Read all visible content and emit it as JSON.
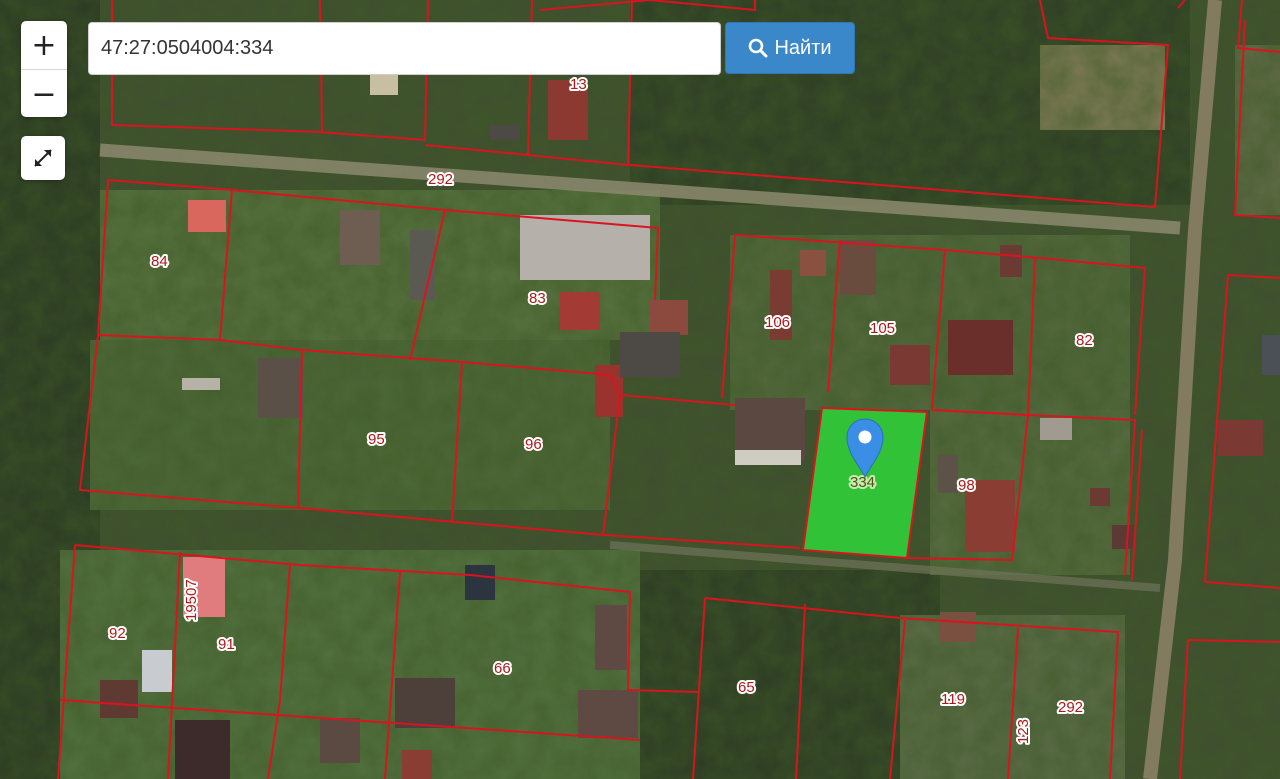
{
  "search": {
    "value": "47:27:0504004:334"
  },
  "search_button": {
    "label": "Найти",
    "icon": "search-icon"
  },
  "zoom": {
    "in_label": "+",
    "out_label": "−"
  },
  "fullscreen": {
    "icon": "expand-icon"
  },
  "map": {
    "boundary_color": "#d9141e",
    "selected_fill": "#2fd63a",
    "selected_parcel": "334",
    "parcel_labels": [
      "13",
      "292",
      "84",
      "83",
      "106",
      "105",
      "82",
      "95",
      "96",
      "334",
      "98",
      "19507",
      "92",
      "91",
      "66",
      "65",
      "119",
      "123",
      "292"
    ]
  }
}
